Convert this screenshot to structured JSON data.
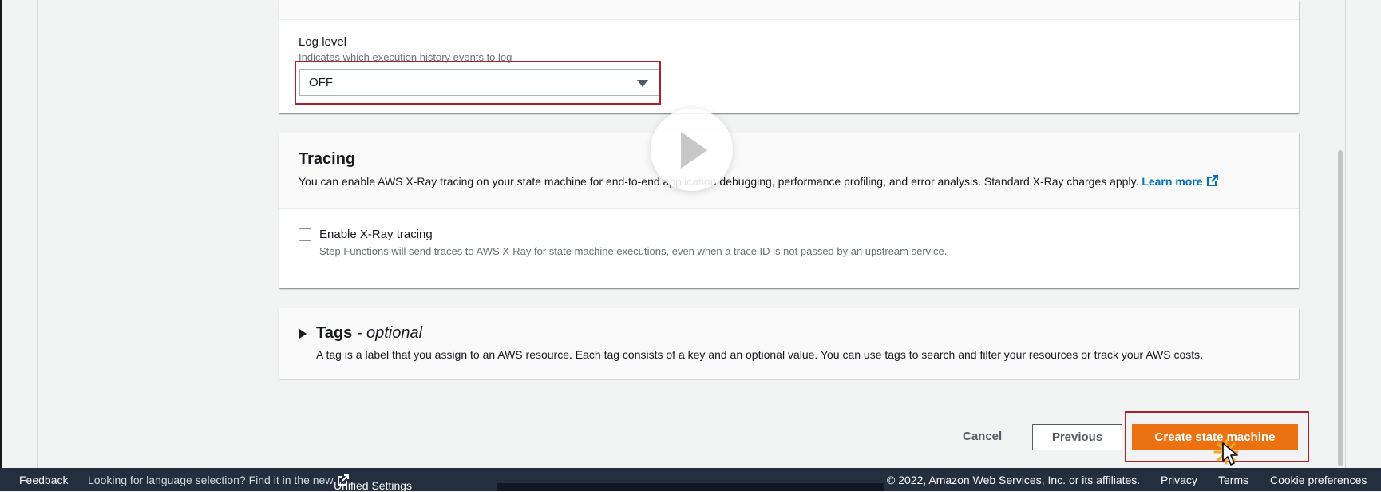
{
  "log_level": {
    "label": "Log level",
    "description": "Indicates which execution history events to log",
    "selected": "OFF"
  },
  "tracing": {
    "title": "Tracing",
    "description": "You can enable AWS X-Ray tracing on your state machine for end-to-end application debugging, performance profiling, and error analysis. Standard X-Ray charges apply.",
    "learn_more": "Learn more",
    "checkbox_label": "Enable X-Ray tracing",
    "checkbox_checked": false,
    "checkbox_desc": "Step Functions will send traces to AWS X-Ray for state machine executions, even when a trace ID is not passed by an upstream service."
  },
  "tags": {
    "title": "Tags",
    "separator": " - ",
    "optional": "optional",
    "description": "A tag is a label that you assign to an AWS resource. Each tag consists of a key and an optional value. You can use tags to search and filter your resources or track your AWS costs."
  },
  "actions": {
    "cancel": "Cancel",
    "previous": "Previous",
    "create": "Create state machine"
  },
  "footer": {
    "feedback": "Feedback",
    "language_prompt": "Looking for language selection? Find it in the new",
    "unified_settings": "Unified Settings",
    "copyright": "© 2022, Amazon Web Services, Inc. or its affiliates.",
    "privacy": "Privacy",
    "terms": "Terms",
    "cookie": "Cookie preferences"
  },
  "colors": {
    "primary_button": "#ec7211",
    "link": "#0073bb",
    "highlight": "#b0202a",
    "footer_bg": "#232f3e"
  }
}
